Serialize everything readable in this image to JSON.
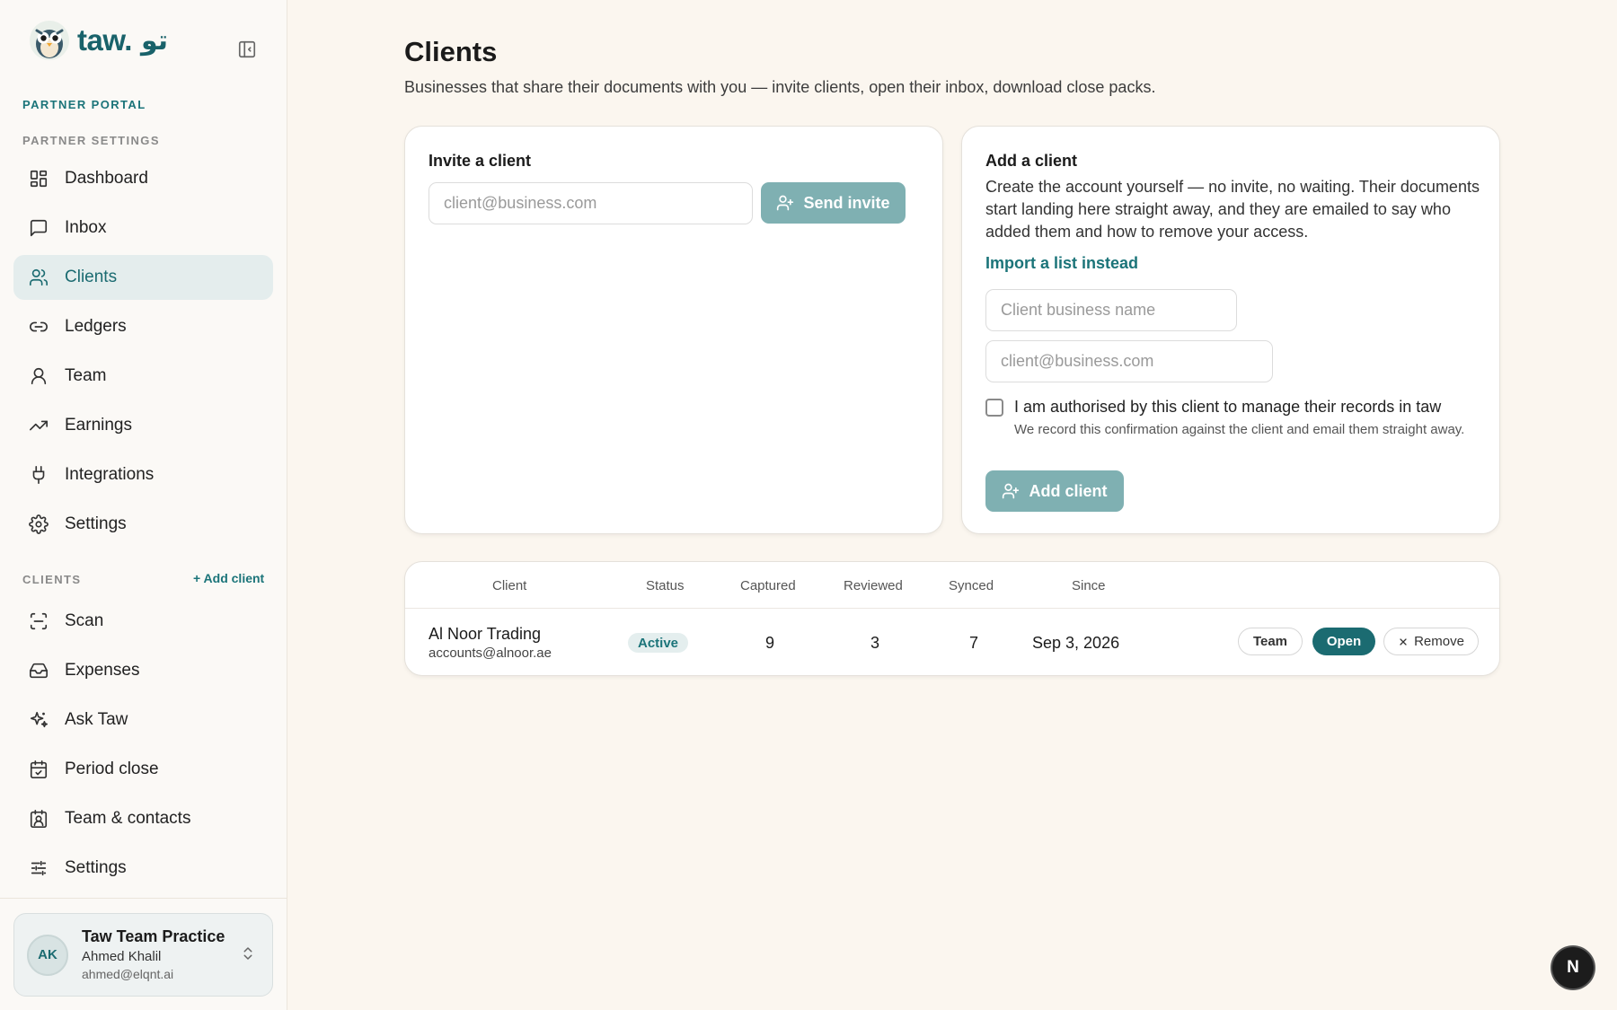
{
  "app": {
    "logo_text": "taw.",
    "logo_arabic": "تو"
  },
  "sidebar": {
    "portal_label": "PARTNER PORTAL",
    "settings_label": "PARTNER SETTINGS",
    "partner_items": [
      {
        "label": "Dashboard",
        "icon": "dashboard-icon"
      },
      {
        "label": "Inbox",
        "icon": "message-icon"
      },
      {
        "label": "Clients",
        "icon": "users-icon",
        "active": true
      },
      {
        "label": "Ledgers",
        "icon": "link-icon"
      },
      {
        "label": "Team",
        "icon": "user-icon"
      },
      {
        "label": "Earnings",
        "icon": "trending-up-icon"
      },
      {
        "label": "Integrations",
        "icon": "plug-icon"
      },
      {
        "label": "Settings",
        "icon": "gear-icon"
      }
    ],
    "clients_label": "CLIENTS",
    "add_client_link": "+ Add client",
    "client_items": [
      {
        "label": "Scan",
        "icon": "scan-icon"
      },
      {
        "label": "Expenses",
        "icon": "inbox-tray-icon"
      },
      {
        "label": "Ask Taw",
        "icon": "sparkles-icon"
      },
      {
        "label": "Period close",
        "icon": "calendar-check-icon"
      },
      {
        "label": "Team & contacts",
        "icon": "contact-icon"
      },
      {
        "label": "Settings",
        "icon": "sliders-icon"
      }
    ],
    "user": {
      "initials": "AK",
      "practice": "Taw Team Practice",
      "name": "Ahmed Khalil",
      "email": "ahmed@elqnt.ai"
    }
  },
  "main": {
    "title": "Clients",
    "subtitle": "Businesses that share their documents with you — invite clients, open their inbox, download close packs."
  },
  "invite_card": {
    "title": "Invite a client",
    "email_placeholder": "client@business.com",
    "send_label": "Send invite"
  },
  "add_card": {
    "title": "Add a client",
    "description": "Create the account yourself — no invite, no waiting. Their documents start landing here straight away, and they are emailed to say who added them and how to remove your access.",
    "import_link": "Import a list instead",
    "name_placeholder": "Client business name",
    "email_placeholder": "client@business.com",
    "checkbox_label": "I am authorised by this client to manage their records in taw",
    "checkbox_hint": "We record this confirmation against the client and email them straight away.",
    "add_label": "Add client"
  },
  "table": {
    "columns": [
      "Client",
      "Status",
      "Captured",
      "Reviewed",
      "Synced",
      "Since"
    ],
    "rows": [
      {
        "name": "Al Noor Trading",
        "email": "accounts@alnoor.ae",
        "status": "Active",
        "captured": "9",
        "reviewed": "3",
        "synced": "7",
        "since": "Sep 3, 2026",
        "team_label": "Team",
        "open_label": "Open",
        "remove_label": "Remove"
      }
    ]
  },
  "fab_label": "N",
  "colors": {
    "accent": "#1b6b71",
    "accent_light": "#7fb0b2",
    "background": "#fbf6ef"
  }
}
